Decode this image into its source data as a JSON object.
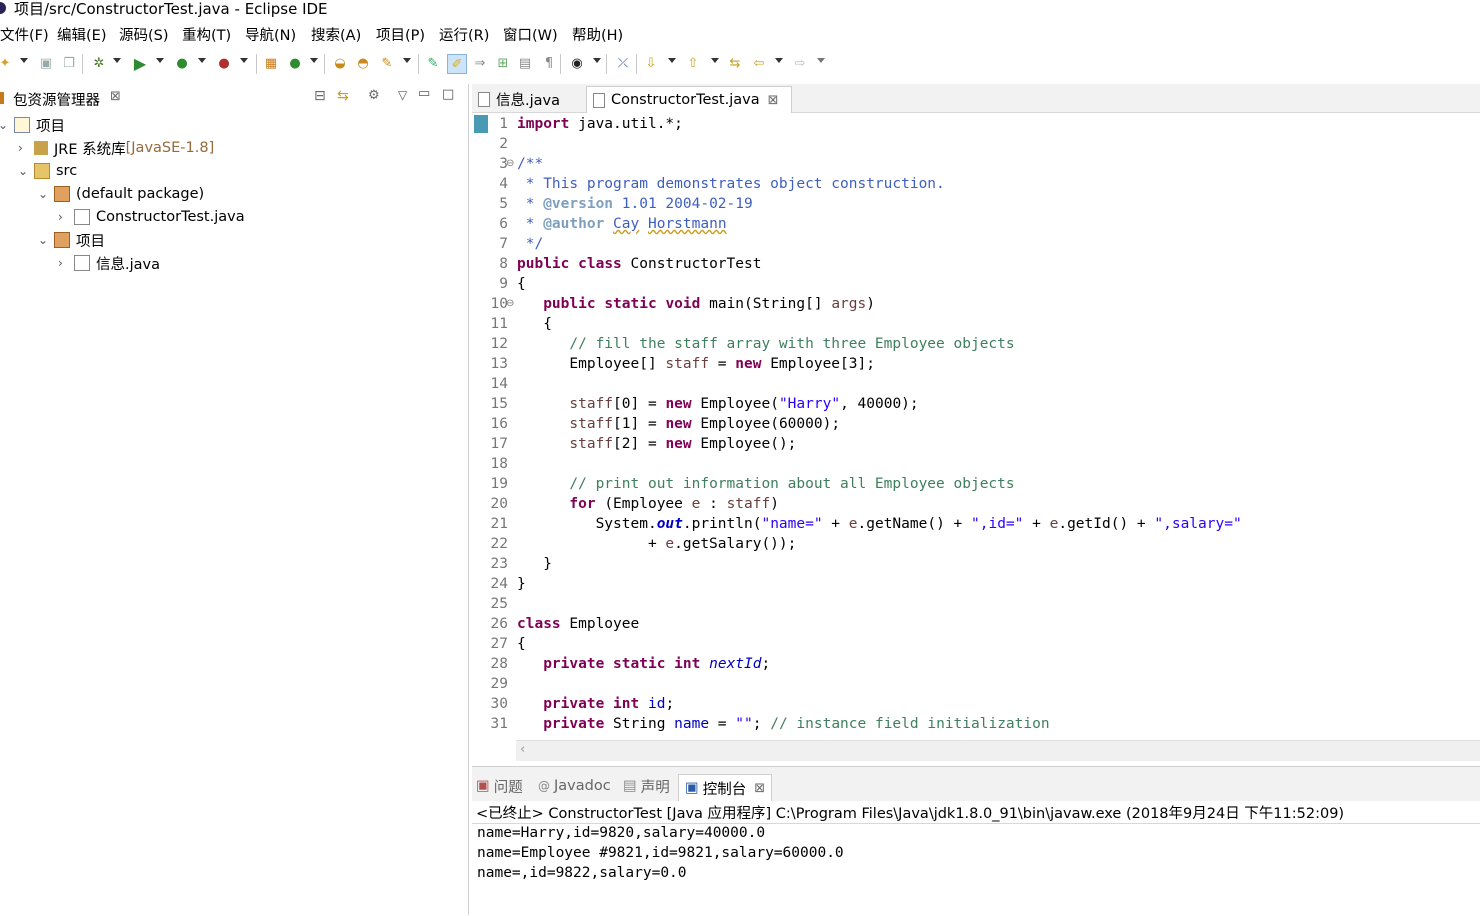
{
  "window": {
    "title": "项目/src/ConstructorTest.java - Eclipse IDE"
  },
  "menu": [
    "文件(F)",
    "编辑(E)",
    "源码(S)",
    "重构(T)",
    "导航(N)",
    "搜索(A)",
    "项目(P)",
    "运行(R)",
    "窗口(W)",
    "帮助(H)"
  ],
  "explorer": {
    "tab_title": "包资源管理器",
    "tree": [
      {
        "label": "项目",
        "suffix": "",
        "icon": "project-icon"
      },
      {
        "label": "JRE 系统库",
        "suffix": " [JavaSE-1.8]",
        "icon": "library-icon"
      },
      {
        "label": "src",
        "suffix": "",
        "icon": "source-folder-icon"
      },
      {
        "label": "(default package)",
        "suffix": "",
        "icon": "package-icon"
      },
      {
        "label": "ConstructorTest.java",
        "suffix": "",
        "icon": "java-file-icon"
      },
      {
        "label": "项目",
        "suffix": "",
        "icon": "package-icon"
      },
      {
        "label": "信息.java",
        "suffix": "",
        "icon": "java-file-icon"
      }
    ]
  },
  "editor": {
    "tabs": [
      {
        "label": "信息.java",
        "active": false
      },
      {
        "label": "ConstructorTest.java",
        "active": true
      }
    ],
    "line_numbers": [
      "1",
      "2",
      "3",
      "4",
      "5",
      "6",
      "7",
      "8",
      "9",
      "10",
      "11",
      "12",
      "13",
      "14",
      "15",
      "16",
      "17",
      "18",
      "19",
      "20",
      "21",
      "22",
      "23",
      "24",
      "25",
      "26",
      "27",
      "28",
      "29",
      "30",
      "31"
    ]
  },
  "console": {
    "tabs": [
      "问题",
      "Javadoc",
      "声明",
      "控制台"
    ],
    "header": "<已终止> ConstructorTest [Java 应用程序] C:\\Program Files\\Java\\jdk1.8.0_91\\bin\\javaw.exe  (2018年9月24日 下午11:52:09)",
    "output": [
      "name=Harry,id=9820,salary=40000.0",
      "name=Employee #9821,id=9821,salary=60000.0",
      "name=,id=9822,salary=0.0"
    ]
  },
  "colors": {
    "keyword": "#7f0055",
    "comment": "#3f7f5f",
    "javadoc": "#3f5fbf",
    "string": "#2a00ff",
    "field": "#0000c0"
  }
}
